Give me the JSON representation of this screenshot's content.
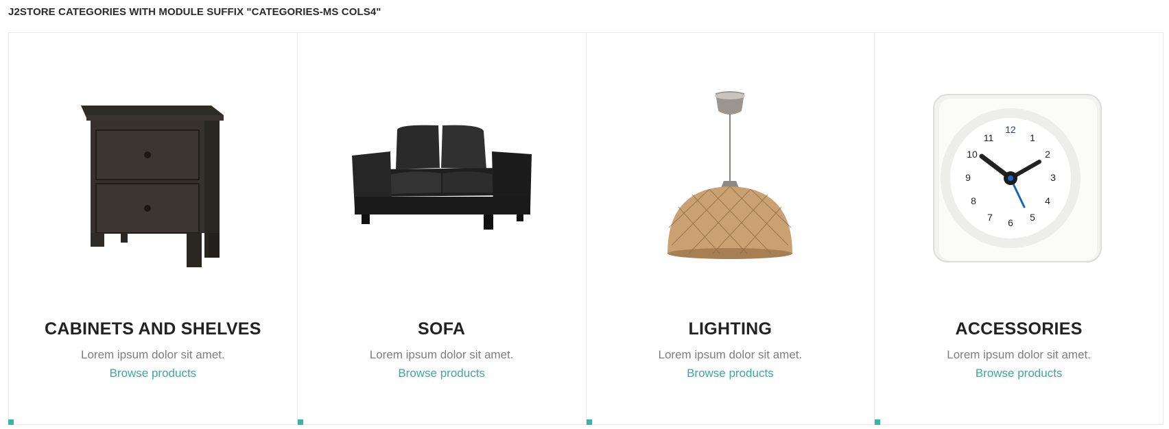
{
  "module": {
    "title": "J2STORE CATEGORIES WITH MODULE SUFFIX \"CATEGORIES-MS COLS4\""
  },
  "categories": [
    {
      "title": "CABINETS AND SHELVES",
      "description": "Lorem ipsum dolor sit amet.",
      "link": "Browse products",
      "image": "nightstand-image"
    },
    {
      "title": "SOFA",
      "description": "Lorem ipsum dolor sit amet.",
      "link": "Browse products",
      "image": "sofa-image"
    },
    {
      "title": "LIGHTING",
      "description": "Lorem ipsum dolor sit amet.",
      "link": "Browse products",
      "image": "pendant-lamp-image"
    },
    {
      "title": "ACCESSORIES",
      "description": "Lorem ipsum dolor sit amet.",
      "link": "Browse products",
      "image": "clock-image"
    }
  ],
  "clock_numbers": [
    "12",
    "1",
    "2",
    "3",
    "4",
    "5",
    "6",
    "7",
    "8",
    "9",
    "10",
    "11"
  ],
  "colors": {
    "accent": "#3ab3a8",
    "link": "#3aa8a2",
    "border": "#e8e8e8"
  }
}
